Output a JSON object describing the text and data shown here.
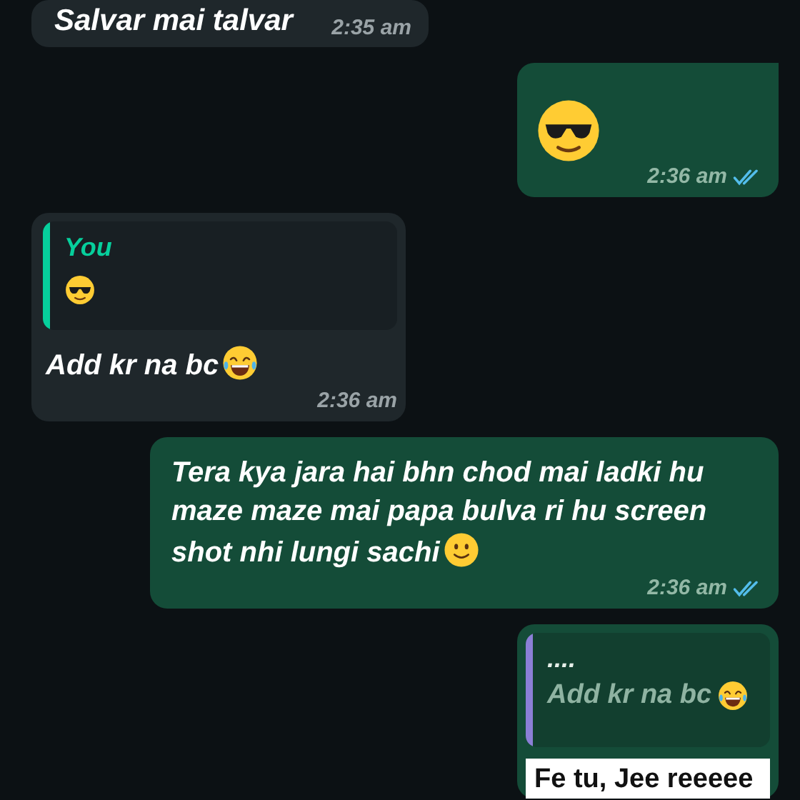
{
  "messages": [
    {
      "outgoing": false,
      "text": "Salvar mai talvar",
      "time": "2:35 am"
    },
    {
      "outgoing": true,
      "emoji": {
        "kind": "sunglasses"
      },
      "time": "2:36 am",
      "read": true
    },
    {
      "outgoing": false,
      "quote": {
        "author": "You",
        "emoji": {
          "kind": "sunglasses"
        },
        "color": "#06cf9c"
      },
      "text": "Add kr na bc",
      "emoji": {
        "kind": "laughing"
      },
      "time": "2:36 am"
    },
    {
      "outgoing": true,
      "text": "Tera kya jara hai bhn chod mai ladki hu maze maze mai papa bulva ri hu screen shot nhi lungi sachi",
      "emoji": {
        "kind": "smile"
      },
      "time": "2:36 am",
      "read": true
    },
    {
      "outgoing": true,
      "quote": {
        "author": "....",
        "text": "Add kr na bc",
        "emoji": {
          "kind": "laughing"
        },
        "color": "#8b7fd6"
      },
      "image_text": "Fe tu, Jee reeeee"
    }
  ]
}
